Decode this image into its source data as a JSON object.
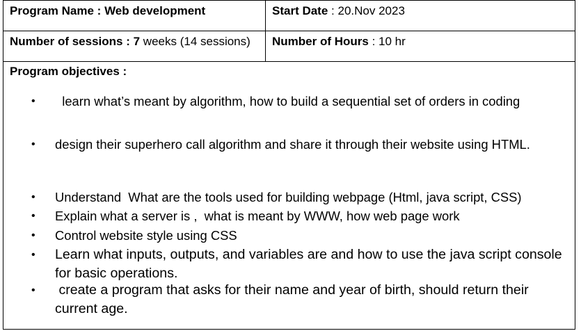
{
  "header": {
    "program_name_label": "Program Name :",
    "program_name_value": "Web development",
    "start_date_label": "Start Date",
    "start_date_value": ": 20.Nov 2023",
    "sessions_label": "Number of sessions : 7",
    "sessions_value": "weeks (14 sessions)",
    "hours_label": "Number of Hours",
    "hours_value": ":   10 hr"
  },
  "objectives": {
    "title": "Program objectives :",
    "bullet_symbol": "•",
    "items": [
      "  learn what’s meant by algorithm, how to build a sequential set of orders in coding",
      "design their superhero call algorithm and share it through their website using HTML.",
      "Understand  What are the tools used for building webpage (Html, java script, CSS)",
      "Explain what a server is ,  what is meant by WWW, how web page work",
      "Control website style using CSS",
      "Learn what inputs, outputs, and variables are and how to use the java script console for basic operations.",
      " create a program that asks for their name and year of birth, should return their current age."
    ]
  }
}
